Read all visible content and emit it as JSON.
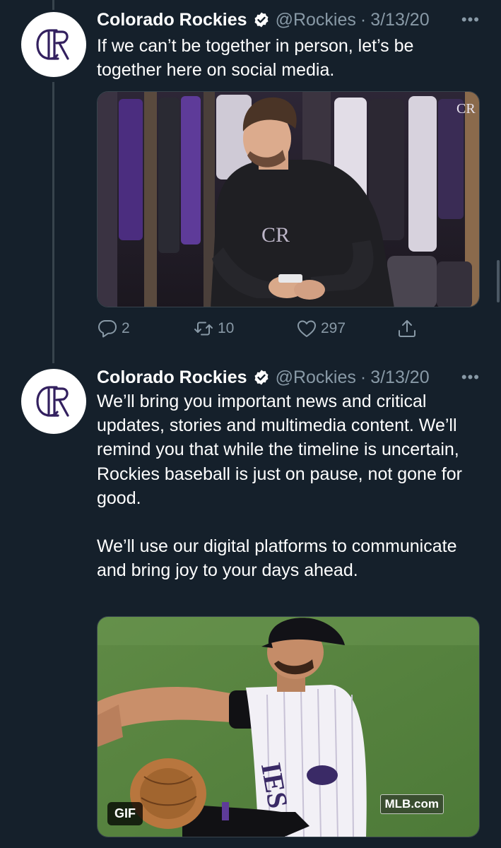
{
  "tweets": [
    {
      "name": "Colorado Rockies",
      "handle": "@Rockies",
      "separator": "·",
      "date": "3/13/20",
      "more": "•••",
      "text": [
        "If we can’t be together in person, let’s be together here on social media."
      ],
      "media": {
        "type": "photo",
        "description": "player-in-locker-room-on-phone"
      },
      "actions": {
        "replies": "2",
        "retweets": "10",
        "likes": "297"
      }
    },
    {
      "name": "Colorado Rockies",
      "handle": "@Rockies",
      "separator": "·",
      "date": "3/13/20",
      "more": "•••",
      "text": [
        "We’ll bring you important news and critical updates, stories and multimedia content. We’ll remind you that while the timeline is uncertain, Rockies baseball is just on pause, not gone for good.",
        "We’ll use our digital platforms to communicate and bring joy to your days ahead."
      ],
      "media": {
        "type": "gif",
        "gif_label": "GIF",
        "watermark": "MLB.com"
      }
    }
  ],
  "colors": {
    "background": "#15202b",
    "secondary_text": "#8899a6",
    "verified": "#ffffff",
    "thread_line": "#38444d"
  },
  "icons": [
    "rockies-logo-icon",
    "verified-badge-icon",
    "more-icon",
    "reply-icon",
    "retweet-icon",
    "like-icon",
    "share-icon"
  ]
}
